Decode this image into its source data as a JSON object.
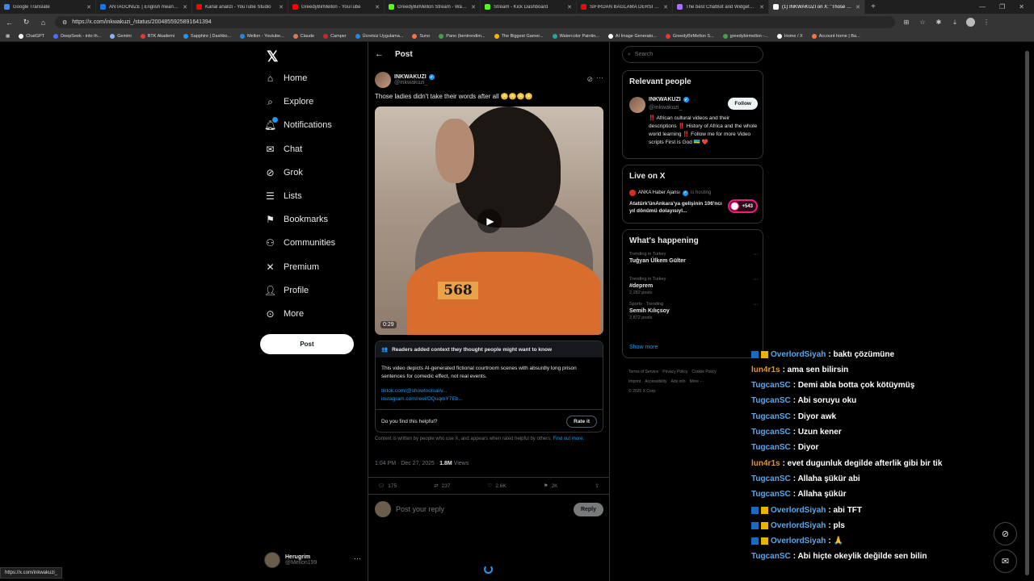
{
  "browser": {
    "tabs": [
      {
        "title": "Google Translate",
        "color": "#4285f4"
      },
      {
        "title": "ANTAGONIZE | English meaning -",
        "color": "#1a73e8"
      },
      {
        "title": "Kanal analizi - YouTube Studio",
        "color": "#ff0000"
      },
      {
        "title": "GreedyBirMellon - YouTube",
        "color": "#ff0000"
      },
      {
        "title": "GreedyBirMellon Stream - Watch",
        "color": "#53fc18"
      },
      {
        "title": "Stream - Kick Dashboard",
        "color": "#53fc18"
      },
      {
        "title": "SIFIRDAN BAĞLAMA DERSİ 3 (EN",
        "color": "#ff0000"
      },
      {
        "title": "The best ChatBot and Widgets fo",
        "color": "#a970ff"
      },
      {
        "title": "(1) INKWAKUZI on X: \"Those ladie",
        "color": "#ffffff",
        "active": true
      }
    ],
    "url": "https://x.com/inkwakuzi_/status/2004855925891641394",
    "bookmarks": [
      {
        "label": "ChatGPT",
        "color": "#ffffff"
      },
      {
        "label": "DeepSeek - into th...",
        "color": "#4d6bfe"
      },
      {
        "label": "Gemini",
        "color": "#8ab4f8"
      },
      {
        "label": "BTK Akademi",
        "color": "#e53935"
      },
      {
        "label": "Sapphire | Dashbo...",
        "color": "#2196f3"
      },
      {
        "label": "Mellon - Youtube...",
        "color": "#1e88e5"
      },
      {
        "label": "Claude",
        "color": "#d97757"
      },
      {
        "label": "Camper",
        "color": "#c62828"
      },
      {
        "label": "Ücretsiz Uygulama...",
        "color": "#1e88e5"
      },
      {
        "label": "Suno",
        "color": "#ff7043"
      },
      {
        "label": "Pano (bentrendim...",
        "color": "#43a047"
      },
      {
        "label": "The Biggest Gamer...",
        "color": "#ffb300"
      },
      {
        "label": "Watercolor Paintin...",
        "color": "#26a69a"
      },
      {
        "label": "AI Image Generato...",
        "color": "#ffffff"
      },
      {
        "label": "GreedyBirMellon S...",
        "color": "#e53935"
      },
      {
        "label": "greedybirmellon -...",
        "color": "#43a047"
      },
      {
        "label": "Home / X",
        "color": "#ffffff"
      },
      {
        "label": "Account home | Ba...",
        "color": "#ff7043"
      }
    ],
    "status_url": "https://x.com/inkwakuzi_"
  },
  "nav": {
    "items": [
      {
        "label": "Home",
        "icon": "home-icon"
      },
      {
        "label": "Explore",
        "icon": "search-icon"
      },
      {
        "label": "Notifications",
        "icon": "bell-icon"
      },
      {
        "label": "Chat",
        "icon": "mail-icon"
      },
      {
        "label": "Grok",
        "icon": "grok-icon"
      },
      {
        "label": "Lists",
        "icon": "list-icon"
      },
      {
        "label": "Bookmarks",
        "icon": "bookmark-icon"
      },
      {
        "label": "Communities",
        "icon": "communities-icon"
      },
      {
        "label": "Premium",
        "icon": "x-icon"
      },
      {
        "label": "Profile",
        "icon": "profile-icon"
      },
      {
        "label": "More",
        "icon": "more-icon"
      }
    ],
    "post_button": "Post",
    "account": {
      "name": "Herugrim",
      "handle": "@Mellon199"
    }
  },
  "post": {
    "header": "Post",
    "author": {
      "name": "INKWAKUZI",
      "handle": "@inkwakuzi_"
    },
    "text": "Those ladies didn't take their words after all 😳😳😳😳",
    "video": {
      "duration": "0:29",
      "tag_number": "568"
    },
    "notes": {
      "header": "Readers added context they thought people might want to know",
      "body": "This video depicts AI-generated fictional courtroom scenes with absurdly long prison sentences for comedic effect, not real events.",
      "links": [
        "tiktok.com/@showtoolsai/v...",
        "instagram.com/reel/DQuqmY7Eb..."
      ],
      "question": "Do you find this helpful?",
      "rate_button": "Rate it"
    },
    "context_info": "Context is written by people who use X, and appears when rated helpful by others.",
    "context_link": "Find out more.",
    "timestamp": "1:04 PM · Dec 27, 2025 · ",
    "views_count": "1.8M",
    "views_label": "Views",
    "stats": {
      "replies": "175",
      "reposts": "237",
      "likes": "2.6K",
      "bookmarks": "2K"
    },
    "reply_placeholder": "Post your reply",
    "reply_button": "Reply"
  },
  "sidebar": {
    "search_placeholder": "Search",
    "relevant_people": {
      "title": "Relevant people",
      "name": "INKWAKUZI",
      "handle": "@inkwakuzi_",
      "follow": "Follow",
      "bio": "‼️ African cultural videos and their descriptions ‼️ History of Africa and the whole world learning ‼️ Follow me for more Video scripts First is God 🇷🇼 ❤️"
    },
    "live": {
      "title": "Live on X",
      "host": "ANKA Haber Ajansı",
      "hosting": "is hosting",
      "stream_title": "Atatürk'ünAnkara'ya gelişinin 106'ncı yıl dönümü dolayısıyl...",
      "listeners": "+543"
    },
    "happening": {
      "title": "What's happening",
      "trends": [
        {
          "meta": "Trending in Turkey",
          "name": "Tuğyan Ülkem Gülter",
          "count": ""
        },
        {
          "meta": "Trending in Turkey",
          "name": "#deprem",
          "count": "2,282 posts"
        },
        {
          "meta": "Sports · Trending",
          "name": "Semih Kılıçsoy",
          "count": "2,872 posts"
        }
      ],
      "show_more": "Show more"
    },
    "footer": [
      "Terms of Service",
      "Privacy Policy",
      "Cookie Policy",
      "Imprint",
      "Accessibility",
      "Ads info",
      "More ···",
      "© 2025 X Corp."
    ]
  },
  "chat": [
    {
      "user": "OverlordSiyah",
      "msg": ": baktı çözümüne",
      "color": "blue",
      "badges": true
    },
    {
      "user": "lun4r1s",
      "msg": ": ama sen bilirsin",
      "color": "orange",
      "badges": false
    },
    {
      "user": "TugcanSC",
      "msg": ": Demi abla botta çok kötüymüş",
      "color": "blue",
      "badges": false
    },
    {
      "user": "TugcanSC",
      "msg": ": Abi soruyu oku",
      "color": "blue",
      "badges": false
    },
    {
      "user": "TugcanSC",
      "msg": ": Diyor awk",
      "color": "blue",
      "badges": false
    },
    {
      "user": "TugcanSC",
      "msg": ": Uzun kener",
      "color": "blue",
      "badges": false
    },
    {
      "user": "TugcanSC",
      "msg": ": Diyor",
      "color": "blue",
      "badges": false
    },
    {
      "user": "lun4r1s",
      "msg": ": evet dugunluk degilde afterlik gibi bir tik",
      "color": "orange",
      "badges": false
    },
    {
      "user": "TugcanSC",
      "msg": ": Allaha şükür abi",
      "color": "blue",
      "badges": false
    },
    {
      "user": "TugcanSC",
      "msg": ": Allaha şükür",
      "color": "blue",
      "badges": false
    },
    {
      "user": "OverlordSiyah",
      "msg": ": abi TFT",
      "color": "blue",
      "badges": true
    },
    {
      "user": "OverlordSiyah",
      "msg": ": pls",
      "color": "blue",
      "badges": true
    },
    {
      "user": "OverlordSiyah",
      "msg": ": 🙏",
      "color": "blue",
      "badges": true
    },
    {
      "user": "TugcanSC",
      "msg": ": Abi hiçte okeylik değilde sen bilin",
      "color": "blue",
      "badges": false
    }
  ]
}
